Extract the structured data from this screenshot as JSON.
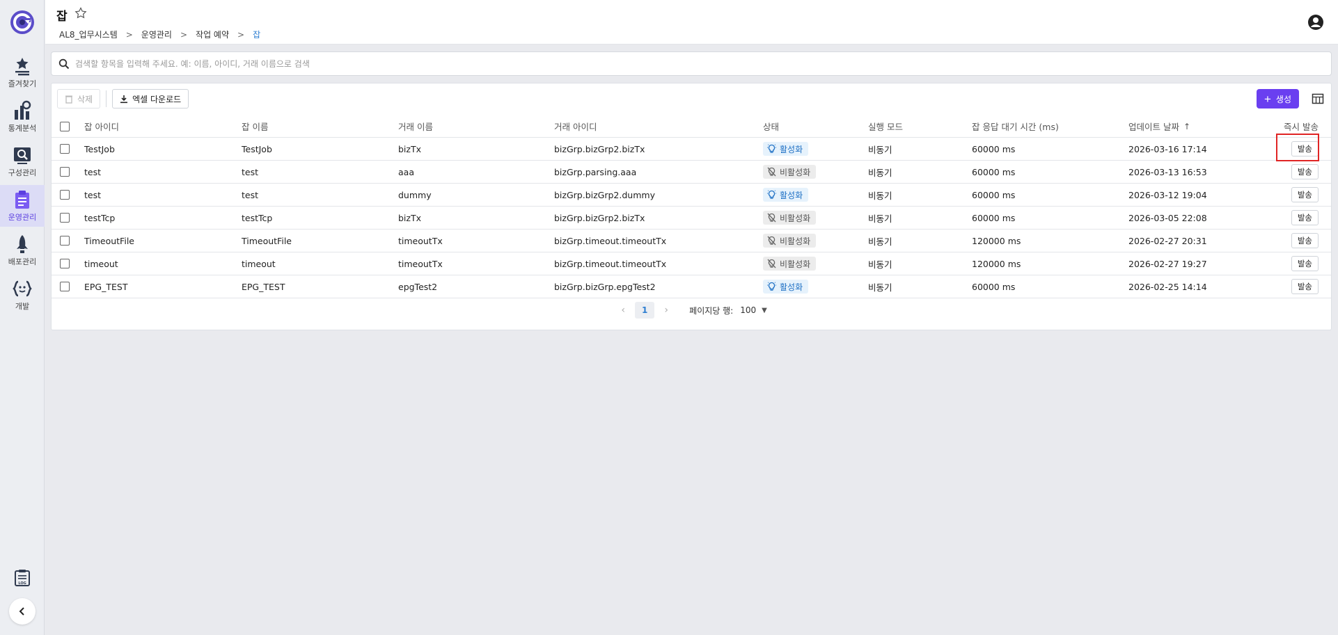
{
  "header": {
    "title": "잡",
    "breadcrumb": [
      "AL8_업무시스템",
      "운영관리",
      "작업 예약",
      "잡"
    ]
  },
  "sidebar": {
    "items": [
      {
        "label": "즐겨찾기",
        "icon": "star-list-icon"
      },
      {
        "label": "통계분석",
        "icon": "chart-icon"
      },
      {
        "label": "구성관리",
        "icon": "config-search-icon"
      },
      {
        "label": "운영관리",
        "icon": "clipboard-icon",
        "active": true
      },
      {
        "label": "배포관리",
        "icon": "rocket-icon"
      },
      {
        "label": "개발",
        "icon": "code-brackets-icon"
      }
    ]
  },
  "search": {
    "placeholder": "검색할 항목을 입력해 주세요. 예: 이름, 아이디, 거래 이름으로 검색"
  },
  "toolbar": {
    "delete_label": "삭제",
    "excel_label": "엑셀 다운로드",
    "create_label": "생성"
  },
  "table": {
    "columns": [
      "잡 아이디",
      "잡 이름",
      "거래 이름",
      "거래 아이디",
      "상태",
      "실행 모드",
      "잡 응답 대기 시간 (ms)",
      "업데이트 날짜",
      "즉시 발송"
    ],
    "rows": [
      {
        "id": "TestJob",
        "name": "TestJob",
        "tx_name": "bizTx",
        "tx_id": "bizGrp.bizGrp2.bizTx",
        "status": "활성화",
        "active": true,
        "mode": "비동기",
        "timeout": "60000 ms",
        "updated": "2026-03-16 17:14",
        "send": "발송"
      },
      {
        "id": "test",
        "name": "test",
        "tx_name": "aaa",
        "tx_id": "bizGrp.parsing.aaa",
        "status": "비활성화",
        "active": false,
        "mode": "비동기",
        "timeout": "60000 ms",
        "updated": "2026-03-13 16:53",
        "send": "발송"
      },
      {
        "id": "test",
        "name": "test",
        "tx_name": "dummy",
        "tx_id": "bizGrp.bizGrp2.dummy",
        "status": "활성화",
        "active": true,
        "mode": "비동기",
        "timeout": "60000 ms",
        "updated": "2026-03-12 19:04",
        "send": "발송"
      },
      {
        "id": "testTcp",
        "name": "testTcp",
        "tx_name": "bizTx",
        "tx_id": "bizGrp.bizGrp2.bizTx",
        "status": "비활성화",
        "active": false,
        "mode": "비동기",
        "timeout": "60000 ms",
        "updated": "2026-03-05 22:08",
        "send": "발송"
      },
      {
        "id": "TimeoutFile",
        "name": "TimeoutFile",
        "tx_name": "timeoutTx",
        "tx_id": "bizGrp.timeout.timeoutTx",
        "status": "비활성화",
        "active": false,
        "mode": "비동기",
        "timeout": "120000 ms",
        "updated": "2026-02-27 20:31",
        "send": "발송"
      },
      {
        "id": "timeout",
        "name": "timeout",
        "tx_name": "timeoutTx",
        "tx_id": "bizGrp.timeout.timeoutTx",
        "status": "비활성화",
        "active": false,
        "mode": "비동기",
        "timeout": "120000 ms",
        "updated": "2026-02-27 19:27",
        "send": "발송"
      },
      {
        "id": "EPG_TEST",
        "name": "EPG_TEST",
        "tx_name": "epgTest2",
        "tx_id": "bizGrp.bizGrp.epgTest2",
        "status": "활성화",
        "active": true,
        "mode": "비동기",
        "timeout": "60000 ms",
        "updated": "2026-02-25 14:14",
        "send": "발송"
      }
    ]
  },
  "pagination": {
    "current_page": "1",
    "rows_per_page_label": "페이지당 행:",
    "rows_per_page": "100"
  },
  "colors": {
    "accent": "#6a3ff0",
    "active_badge_bg": "#e6f2fc",
    "active_badge_text": "#1d6fc4",
    "inactive_badge_bg": "#ececec",
    "highlight": "#e02424"
  }
}
